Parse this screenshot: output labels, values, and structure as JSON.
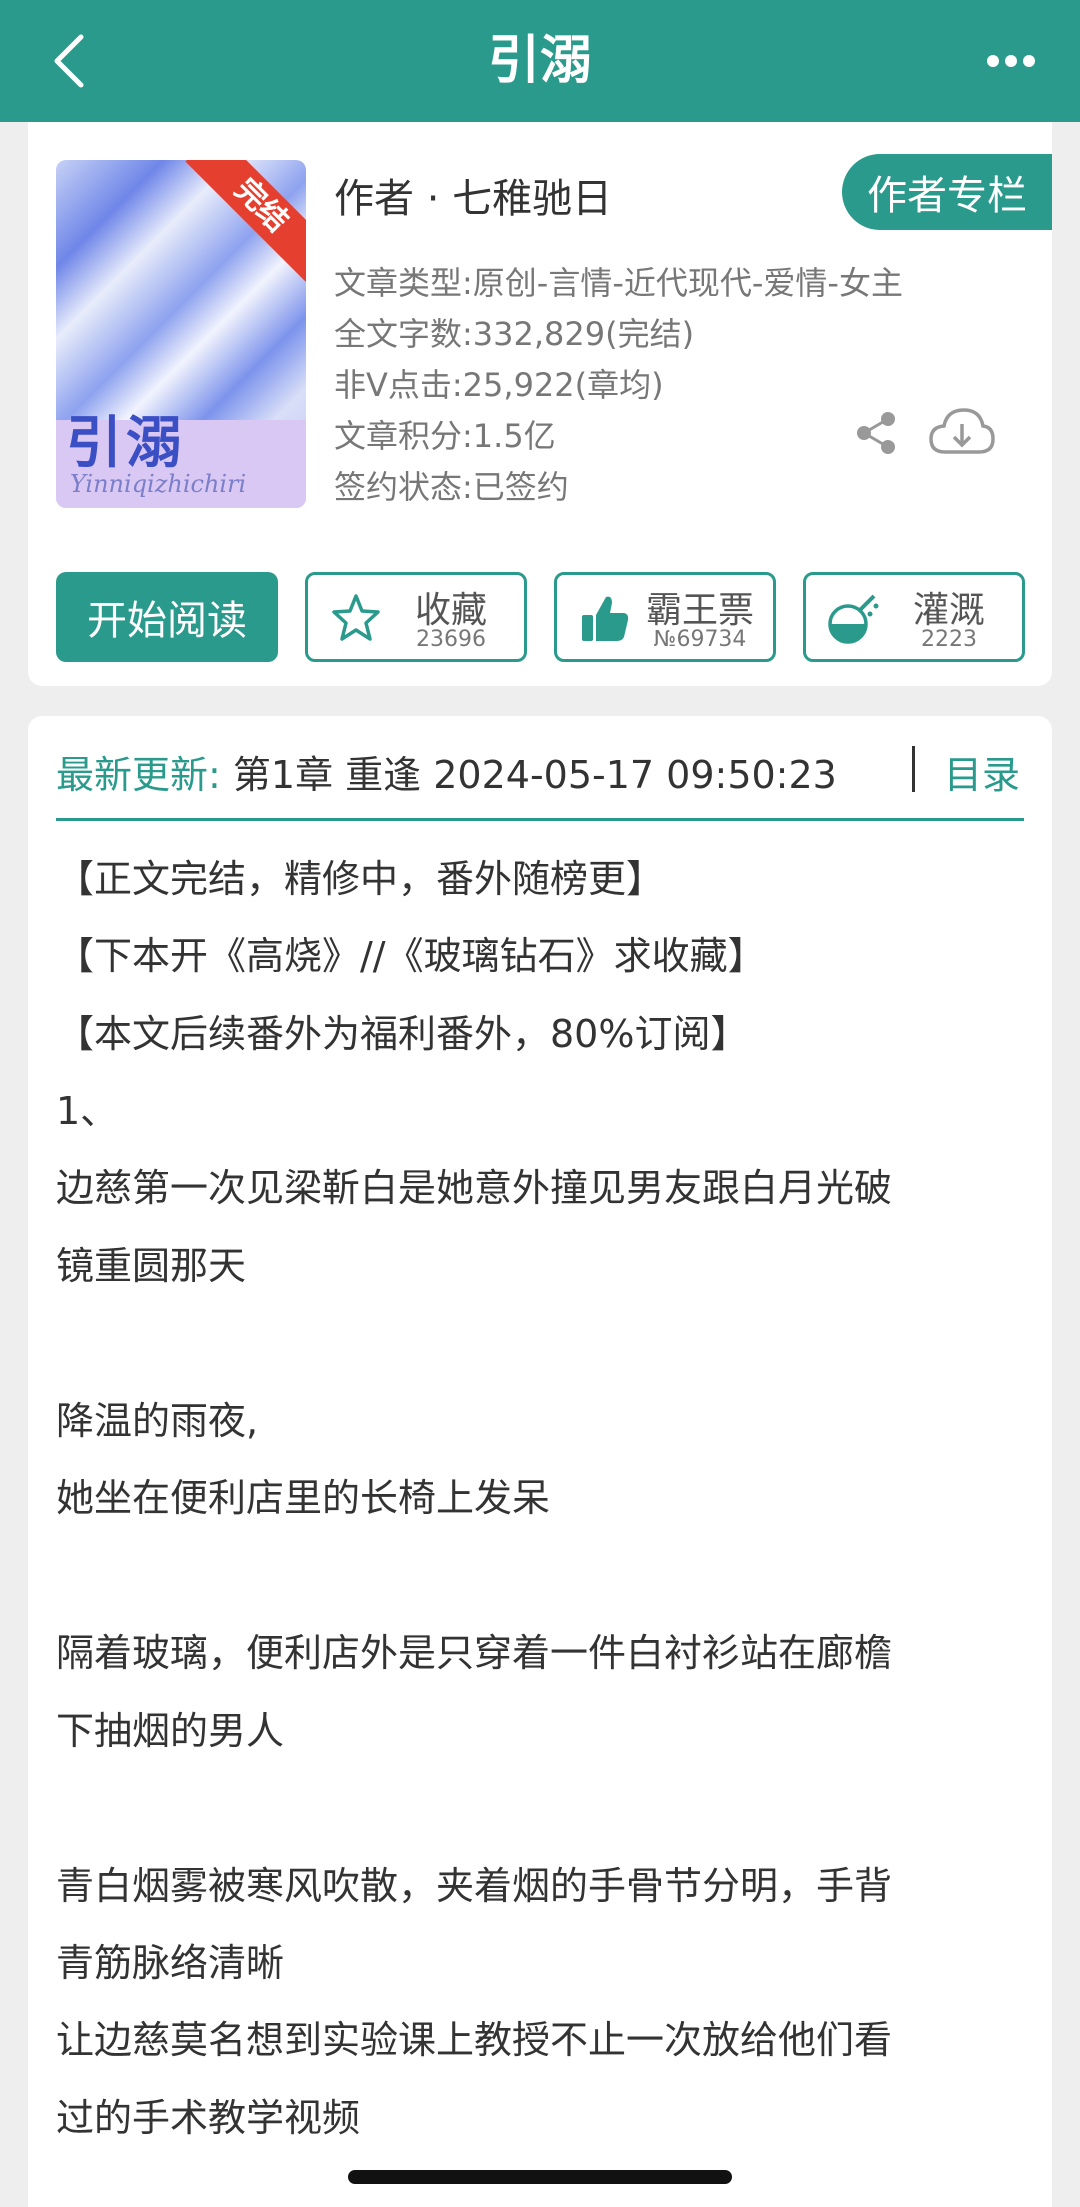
{
  "header": {
    "title": "引溺"
  },
  "book": {
    "cover_title": "引溺",
    "cover_subtitle": "Yinniqizhichiri",
    "status_ribbon": "完结",
    "author_line": "作者 · 七稚驰日",
    "author_column_label": "作者专栏",
    "meta": [
      "文章类型:原创-言情-近代现代-爱情-女主",
      "全文字数:332,829(完结)",
      "非Ⅴ点击:25,922(章均)",
      "文章积分:1.5亿",
      "签约状态:已签约"
    ]
  },
  "actions": {
    "read_label": "开始阅读",
    "favorite": {
      "label": "收藏",
      "count": "23696"
    },
    "vote": {
      "label": "霸王票",
      "count": "№69734"
    },
    "water": {
      "label": "灌溉",
      "count": "2223"
    }
  },
  "update": {
    "label": "最新更新:",
    "text": "第1章 重逢 2024-05-17 09:50:23",
    "toc_label": "目录"
  },
  "content": {
    "lines": [
      "【正文完结，精修中，番外随榜更】",
      "【下本开《高烧》//《玻璃钻石》求收藏】",
      "【本文后续番外为福利番外，80%订阅】",
      "1、",
      "边慈第一次见梁靳白是她意外撞见男友跟白月光破",
      "镜重圆那天",
      "降温的雨夜,",
      "她坐在便利店里的长椅上发呆",
      "隔着玻璃，便利店外是只穿着一件白衬衫站在廊檐",
      "下抽烟的男人",
      "青白烟雾被寒风吹散，夹着烟的手骨节分明，手背",
      "青筋脉络清晰",
      "让边慈莫名想到实验课上教授不止一次放给他们看",
      "过的手术教学视频"
    ]
  },
  "icons": {
    "back": "chevron-left-icon",
    "more": "more-dots-icon",
    "share": "share-icon",
    "download": "cloud-download-icon",
    "favorite": "star-icon",
    "vote": "thumbs-up-icon",
    "water": "watering-flask-icon"
  },
  "colors": {
    "accent": "#2a9a8c",
    "ribbon": "#e5402f",
    "background": "#eeeeee"
  }
}
